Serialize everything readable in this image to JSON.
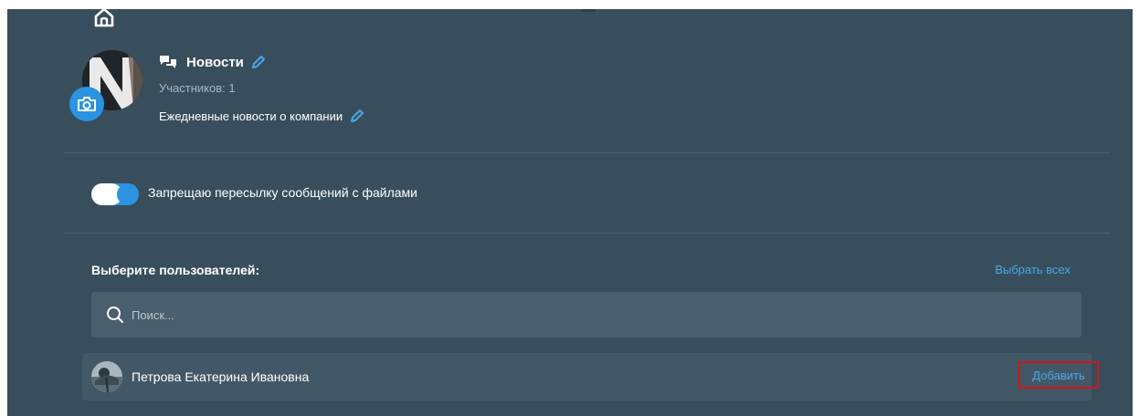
{
  "chat": {
    "title": "Новости",
    "members": "Участников: 1",
    "description": "Ежедневные новости о компании"
  },
  "settings": {
    "forward_toggle_label": "Запрещаю пересылку сообщений с файлами",
    "forward_toggle_on": true
  },
  "users": {
    "heading": "Выберите пользователей:",
    "select_all": "Выбрать всех",
    "search_placeholder": "Поиск...",
    "list": [
      {
        "name": "Петрова Екатерина Ивановна",
        "action": "Добавить"
      }
    ]
  },
  "colors": {
    "panel_bg": "#384e5c",
    "accent": "#2b93e0",
    "link": "#47a8e8",
    "highlight_border": "#d8141b"
  }
}
